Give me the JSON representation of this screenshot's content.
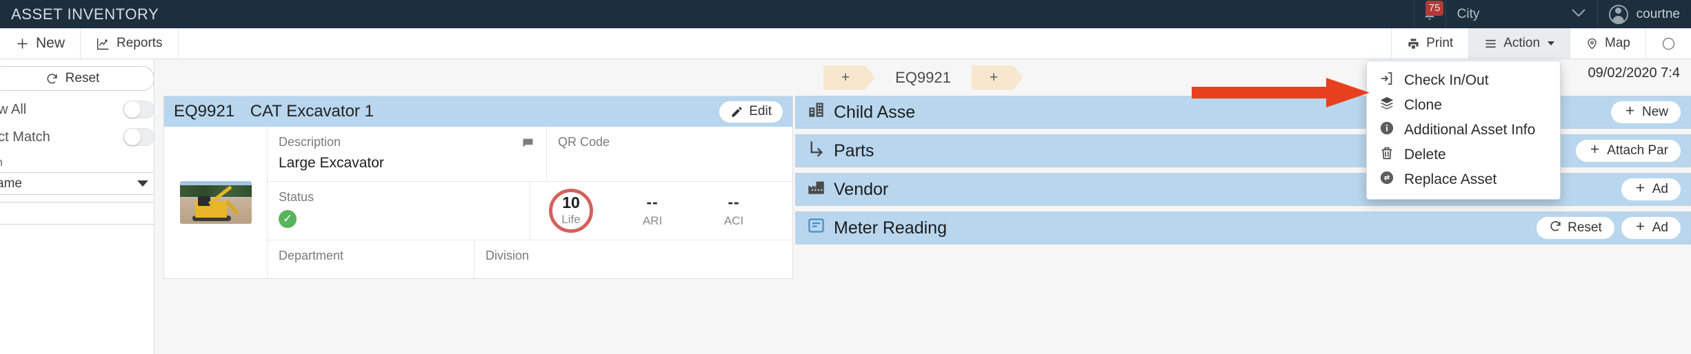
{
  "header": {
    "app_title": "ASSET INVENTORY",
    "notification_count": "75",
    "city_selector": "City",
    "user_name": "courtne",
    "bell_icon": "bell-icon",
    "chevron_icon": "chevron-down-icon",
    "avatar_icon": "user-avatar-icon"
  },
  "toolbar": {
    "new_label": "New",
    "reports_label": "Reports",
    "print_label": "Print",
    "action_label": "Action",
    "map_label": "Map",
    "new_icon": "plus-icon",
    "reports_icon": "chart-icon",
    "print_icon": "printer-icon",
    "action_icon": "hamburger-icon",
    "map_icon": "map-marker-icon",
    "help_icon": "help-circle-icon"
  },
  "sidebar": {
    "reset_label": "Reset",
    "reset_icon": "refresh-icon",
    "toggles": [
      {
        "label": "ow All",
        "full_label": "Show All",
        "state": "off"
      },
      {
        "label": "act Match",
        "full_label": "Exact Match",
        "state": "off"
      }
    ],
    "search_section_label": "ch",
    "field_select_value": "ame",
    "search_value": "",
    "search_placeholder": "",
    "search_icon": "magnifier-icon"
  },
  "tabs": {
    "left_add": "+",
    "center_label": "EQ9921",
    "right_add": "+"
  },
  "asset_card": {
    "code": "EQ9921",
    "name": "CAT Excavator 1",
    "edit_label": "Edit",
    "edit_icon": "pencil-icon",
    "thumbnail_alt": "excavator-photo",
    "fields": {
      "description_label": "Description",
      "description_value": "Large Excavator",
      "qr_label": "QR Code",
      "qr_value": "",
      "status_label": "Status",
      "status_value": "OK",
      "department_label": "Department",
      "division_label": "Division",
      "comment_icon": "comment-icon"
    },
    "metrics": [
      {
        "value": "10",
        "caption": "Life",
        "highlight": "#d4615c"
      },
      {
        "value": "--",
        "caption": "ARI",
        "highlight": ""
      },
      {
        "value": "--",
        "caption": "ACI",
        "highlight": ""
      }
    ]
  },
  "right_panel": {
    "timestamp": "09/02/2020 7:4",
    "sections": [
      {
        "title": "Child Asse",
        "icon": "building-icon",
        "buttons": [
          {
            "label": "New",
            "icon": "plus-icon"
          }
        ]
      },
      {
        "title": "Parts",
        "icon": "parts-corner-icon",
        "buttons": [
          {
            "label": "Attach Par",
            "icon": "plus-icon"
          }
        ]
      },
      {
        "title": "Vendor",
        "icon": "factory-icon",
        "buttons": [
          {
            "label": "Ad",
            "icon": "plus-icon"
          }
        ]
      },
      {
        "title": "Meter Reading",
        "icon": "meter-icon",
        "buttons": [
          {
            "label": "Reset",
            "icon": "refresh-icon"
          },
          {
            "label": "Ad",
            "icon": "plus-icon"
          }
        ]
      }
    ]
  },
  "action_menu": {
    "items": [
      {
        "label": "Check In/Out",
        "icon": "check-in-out-icon"
      },
      {
        "label": "Clone",
        "icon": "layers-icon"
      },
      {
        "label": "Additional Asset Info",
        "icon": "info-circle-icon"
      },
      {
        "label": "Delete",
        "icon": "trash-icon"
      },
      {
        "label": "Replace Asset",
        "icon": "replace-icon"
      }
    ]
  },
  "annotation": {
    "arrow_color": "#e8401f",
    "arrow_target": "Clone"
  },
  "colors": {
    "header_bg": "#1d2e3d",
    "section_bg": "#b8d6ee",
    "tab_bg": "#f7e7cf",
    "badge_bg": "#b03a36",
    "status_green": "#58b55c",
    "life_ring": "#d4615c"
  }
}
